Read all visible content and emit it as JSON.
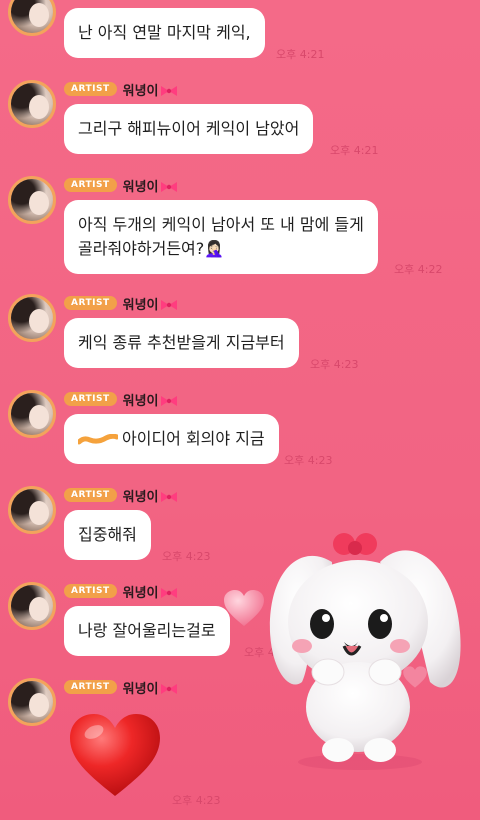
{
  "sender_badge": "ARTIST",
  "sender_name": "워녕이",
  "messages": [
    {
      "text": "난 아직 연말 마지막 케익,",
      "time": "오후 4:21"
    },
    {
      "text": "그리구 해피뉴이어 케익이 남았어",
      "time": "오후 4:21"
    },
    {
      "text_line1": "아직 두개의 케익이 남아서 또 내 맘에 들게",
      "text_line2": "골라줘야하거든여?🤦🏻‍♀️",
      "time": "오후 4:22"
    },
    {
      "text": "케익 종류 추천받을게 지금부터",
      "time": "오후 4:23"
    },
    {
      "text": "아이디어 회의야 지금",
      "time": "오후 4:23"
    },
    {
      "text": "집중해줘",
      "time": "오후 4:23"
    },
    {
      "text": "나랑 잘어울리는걸로",
      "time": "오후 4:23"
    },
    {
      "sticker": "red-heart",
      "time": "오후 4:23"
    }
  ],
  "colors": {
    "background": "#f46a88",
    "badge": "#f2a049",
    "time": "#d8486b"
  }
}
